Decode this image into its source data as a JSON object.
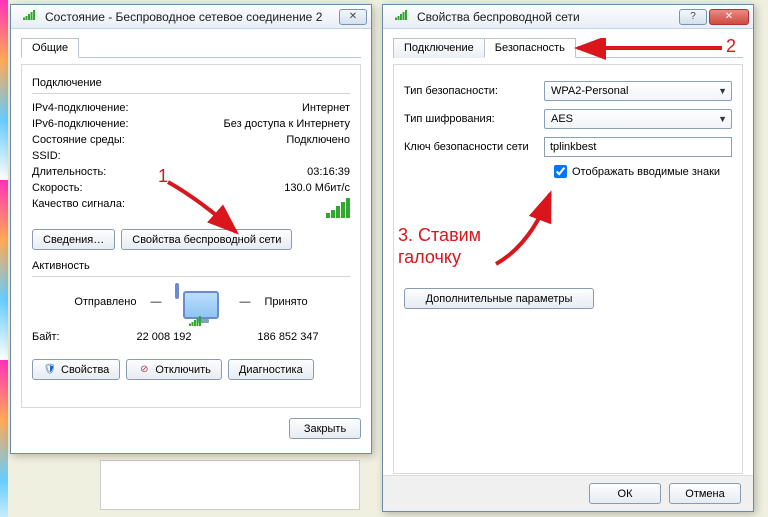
{
  "status_window": {
    "title": "Состояние - Беспроводное сетевое соединение 2",
    "tab_general": "Общие",
    "section_connection": "Подключение",
    "rows": {
      "ipv4_label": "IPv4-подключение:",
      "ipv4_value": "Интернет",
      "ipv6_label": "IPv6-подключение:",
      "ipv6_value": "Без доступа к Интернету",
      "media_label": "Состояние среды:",
      "media_value": "Подключено",
      "ssid_label": "SSID:",
      "ssid_value": "",
      "duration_label": "Длительность:",
      "duration_value": "03:16:39",
      "speed_label": "Скорость:",
      "speed_value": "130.0 Мбит/с",
      "signal_label": "Качество сигнала:"
    },
    "btn_details": "Сведения…",
    "btn_wifi_props": "Свойства беспроводной сети",
    "section_activity": "Активность",
    "sent_label": "Отправлено",
    "recv_label": "Принято",
    "bytes_label": "Байт:",
    "bytes_sent": "22 008 192",
    "bytes_recv": "186 852 347",
    "btn_props": "Свойства",
    "btn_disable": "Отключить",
    "btn_diag": "Диагностика",
    "btn_close": "Закрыть"
  },
  "props_window": {
    "title": "Свойства беспроводной сети",
    "tab_connection": "Подключение",
    "tab_security": "Безопасность",
    "sec_type_label": "Тип безопасности:",
    "sec_type_value": "WPA2-Personal",
    "enc_label": "Тип шифрования:",
    "enc_value": "AES",
    "key_label": "Ключ безопасности сети",
    "key_value": "tplinkbest",
    "show_chars": "Отображать вводимые знаки",
    "btn_advanced": "Дополнительные параметры",
    "btn_ok": "ОК",
    "btn_cancel": "Отмена"
  },
  "annotations": {
    "n1": "1",
    "n2": "2",
    "n3_line1": "3. Ставим",
    "n3_line2": "галочку"
  }
}
